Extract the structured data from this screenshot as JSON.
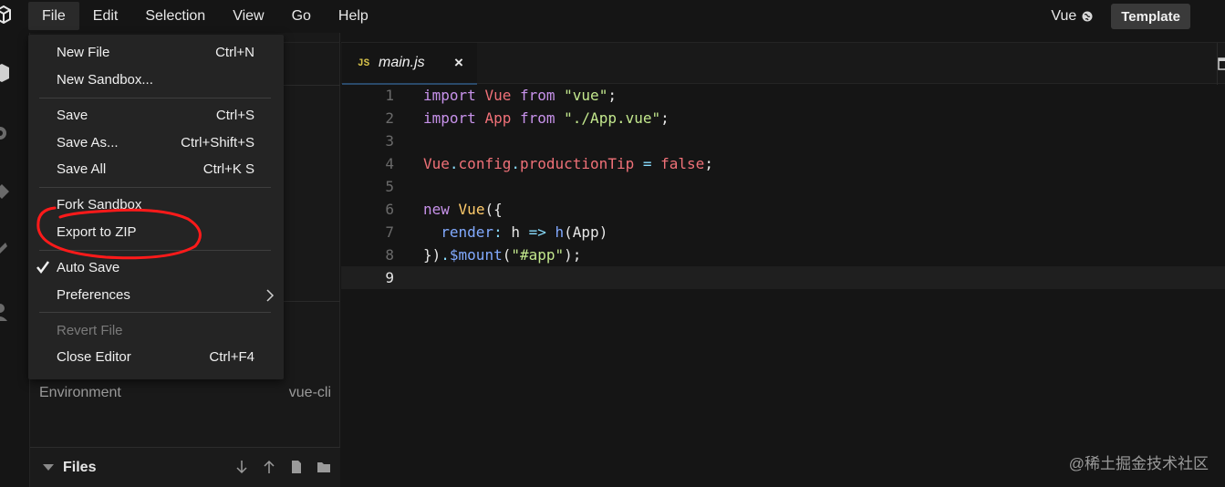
{
  "menubar": {
    "items": [
      {
        "label": "File",
        "active": true
      },
      {
        "label": "Edit"
      },
      {
        "label": "Selection"
      },
      {
        "label": "View"
      },
      {
        "label": "Go"
      },
      {
        "label": "Help"
      }
    ],
    "framework_label": "Vue",
    "template_button": "Template"
  },
  "file_menu": {
    "new_file": {
      "label": "New File",
      "shortcut": "Ctrl+N"
    },
    "new_sandbox": {
      "label": "New Sandbox..."
    },
    "save": {
      "label": "Save",
      "shortcut": "Ctrl+S"
    },
    "save_as": {
      "label": "Save As...",
      "shortcut": "Ctrl+Shift+S"
    },
    "save_all": {
      "label": "Save All",
      "shortcut": "Ctrl+K S"
    },
    "fork_sandbox": {
      "label": "Fork Sandbox"
    },
    "export_zip": {
      "label": "Export to ZIP"
    },
    "auto_save": {
      "label": "Auto Save",
      "checked": true
    },
    "preferences": {
      "label": "Preferences"
    },
    "revert_file": {
      "label": "Revert File",
      "disabled": true
    },
    "close_editor": {
      "label": "Close Editor",
      "shortcut": "Ctrl+F4"
    }
  },
  "sidebar": {
    "environment_label": "Environment",
    "environment_value": "vue-cli",
    "files_label": "Files"
  },
  "editor": {
    "tab": {
      "lang": "JS",
      "name": "main.js",
      "close": "×"
    },
    "line_numbers": [
      "1",
      "2",
      "3",
      "4",
      "5",
      "6",
      "7",
      "8",
      "9"
    ],
    "current_line": 9
  },
  "watermark": "@稀土掘金技术社区",
  "colors": {
    "background": "#151515",
    "menu_bg": "#242424",
    "keyword": "#c792ea",
    "string": "#c3e88d",
    "identifier": "#f07178",
    "annotation": "#ff1a1a"
  }
}
